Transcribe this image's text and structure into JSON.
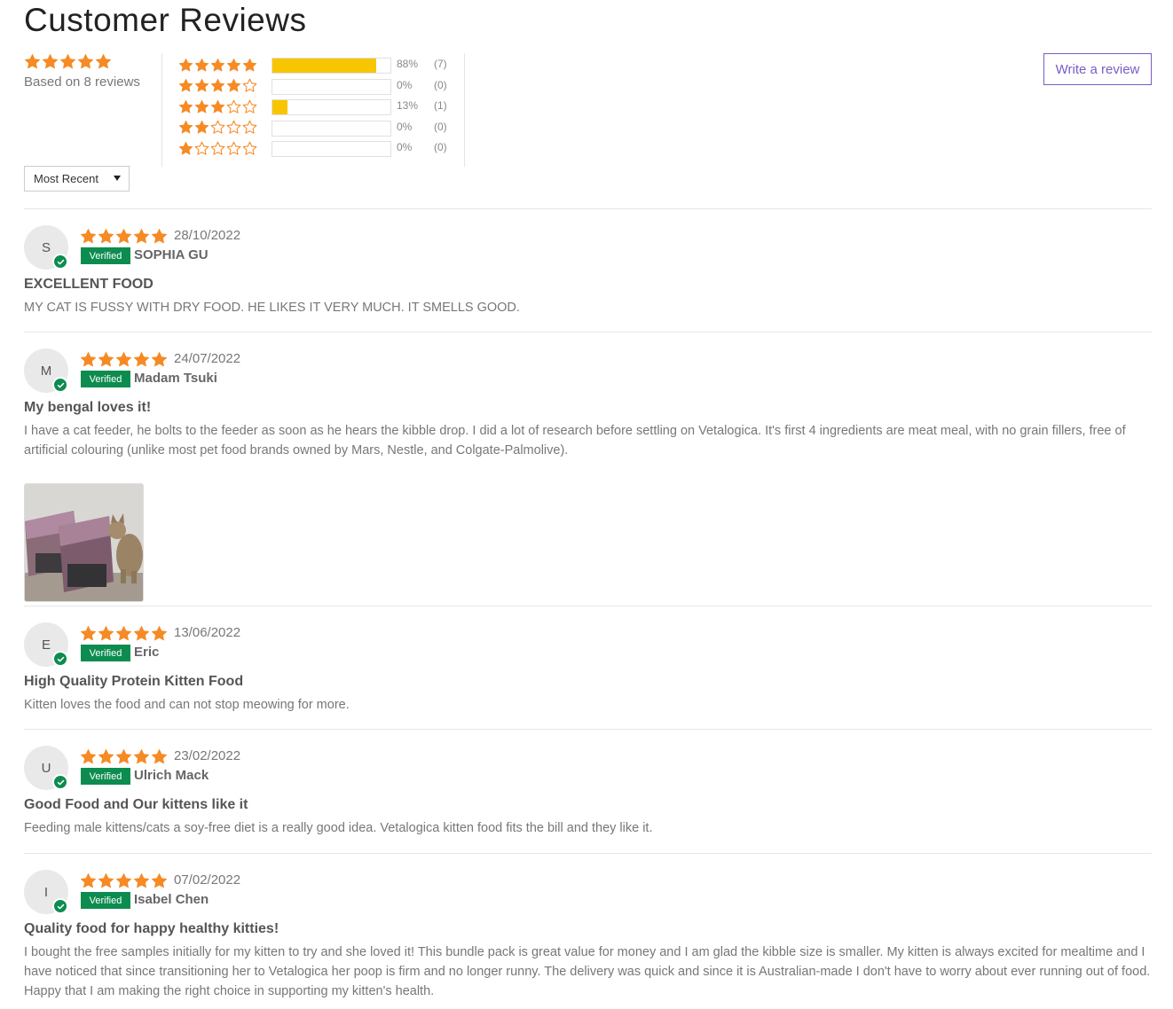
{
  "page": {
    "title": "Customer Reviews"
  },
  "summary": {
    "average_rating": 5,
    "based_on": "Based on 8 reviews",
    "histogram": [
      {
        "stars": 5,
        "fraction": 0.88,
        "pct": "88%",
        "count": "(7)"
      },
      {
        "stars": 4,
        "fraction": 0.0,
        "pct": "0%",
        "count": "(0)"
      },
      {
        "stars": 3,
        "fraction": 0.13,
        "pct": "13%",
        "count": "(1)"
      },
      {
        "stars": 2,
        "fraction": 0.0,
        "pct": "0%",
        "count": "(0)"
      },
      {
        "stars": 1,
        "fraction": 0.0,
        "pct": "0%",
        "count": "(0)"
      }
    ]
  },
  "actions": {
    "write_review": "Write a review"
  },
  "sort": {
    "selected": "Most Recent"
  },
  "verified_label": "Verified",
  "colors": {
    "star": "#f68a24",
    "bar": "#f7c600",
    "verified": "#0d8c4f",
    "accent": "#7a5cc7"
  },
  "reviews": [
    {
      "initial": "S",
      "rating": 5,
      "date": "28/10/2022",
      "author": "SOPHIA GU",
      "title": "EXCELLENT FOOD",
      "body": "MY CAT IS FUSSY WITH DRY FOOD. HE LIKES IT VERY MUCH. IT SMELLS GOOD."
    },
    {
      "initial": "M",
      "rating": 5,
      "date": "24/07/2022",
      "author": "Madam Tsuki",
      "title": "My bengal loves it!",
      "body": "I have a cat feeder, he bolts to the feeder as soon as he hears the kibble drop. I did a lot of research before settling on Vetalogica. It's first 4 ingredients are meat meal, with no grain fillers, free of artificial colouring (unlike most pet food brands owned by Mars, Nestle, and Colgate-Palmolive).",
      "has_photo": true
    },
    {
      "initial": "E",
      "rating": 5,
      "date": "13/06/2022",
      "author": "Eric",
      "title": "High Quality Protein Kitten Food",
      "body": "Kitten loves the food and can not stop meowing for more."
    },
    {
      "initial": "U",
      "rating": 5,
      "date": "23/02/2022",
      "author": "Ulrich Mack",
      "title": "Good Food and Our kittens like it",
      "body": "Feeding male kittens/cats a soy-free diet is a really good idea. Vetalogica kitten food fits the bill and they like it."
    },
    {
      "initial": "I",
      "rating": 5,
      "date": "07/02/2022",
      "author": "Isabel Chen",
      "title": "Quality food for happy healthy kitties!",
      "body": "I bought the free samples initially for my kitten to try and she loved it! This bundle pack is great value for money and I am glad the kibble size is smaller. My kitten is always excited for mealtime and I have noticed that since transitioning her to Vetalogica her poop is firm and no longer runny. The delivery was quick and since it is Australian-made I don't have to worry about ever running out of food. Happy that I am making the right choice in supporting my kitten's health."
    }
  ]
}
